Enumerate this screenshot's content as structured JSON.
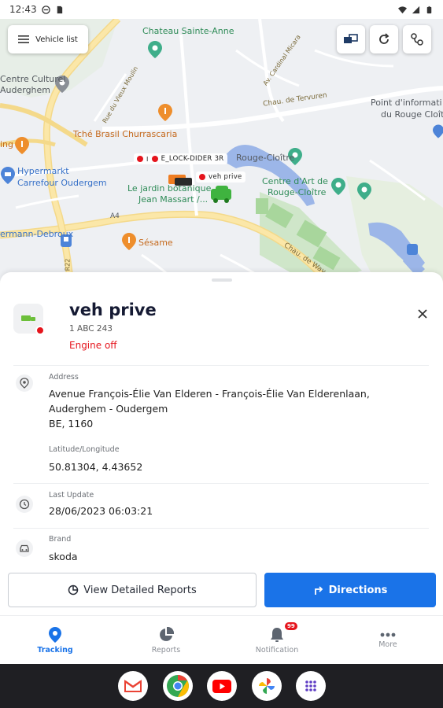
{
  "status_bar": {
    "time": "12:43"
  },
  "map": {
    "vehicle_list_label": "Vehicle list",
    "labels": {
      "chateau": "Chateau Sainte-Anne",
      "centre_culturel_1": "Centre Culturel",
      "centre_culturel_2": "Auderghem",
      "rue_vieux_moulin": "Rue du Vieux Moulin",
      "av_cardinal": "Av. Cardinal Micara",
      "chau_tervuren": "Chau. de Tervuren",
      "point_info_1": "Point d'informati",
      "point_info_2": "du Rouge Cloît",
      "tche_brasil": "Tché Brasil Churrascaria",
      "ing": "ing",
      "rouge_cloitre": "Rouge-Cloître",
      "hypermarkt_1": "Hypermarkt",
      "hypermarkt_2": "Carrefour Oudergem",
      "centre_art_1": "Centre d'Art de",
      "centre_art_2": "Rouge-Cloître",
      "jardin_1": "Le jardin botanique",
      "jardin_2": "Jean Massart /...",
      "a4": "A4",
      "hermann": "ermann-Debroux",
      "sesame": "Sésame",
      "r22": "R22",
      "chau_wavre": "Chau. de Wav"
    },
    "vehicle_tags": {
      "lock_dider": "E_LOCK-DIDER 3R",
      "veh_prive": "veh prive"
    }
  },
  "vehicle": {
    "name": "veh prive",
    "plate": "1 ABC 243",
    "status": "Engine off",
    "address_label": "Address",
    "address_line1": "Avenue François-Élie Van Elderen - François-Élie Van Elderenlaan,",
    "address_line2": "Auderghem - Oudergem",
    "address_line3": "BE, 1160",
    "latlng_label": "Latitude/Longitude",
    "latlng_value": "50.81304, 4.43652",
    "last_update_label": "Last Update",
    "last_update_value": "28/06/2023 06:03:21",
    "brand_label": "Brand",
    "brand_value": "skoda"
  },
  "actions": {
    "reports_label": "View Detailed Reports",
    "directions_label": "Directions"
  },
  "bottom_nav": {
    "tracking": "Tracking",
    "reports": "Reports",
    "notification": "Notification",
    "notification_badge": "99",
    "more": "More"
  },
  "colors": {
    "accent": "#1a73e8",
    "danger": "#e5141c"
  }
}
